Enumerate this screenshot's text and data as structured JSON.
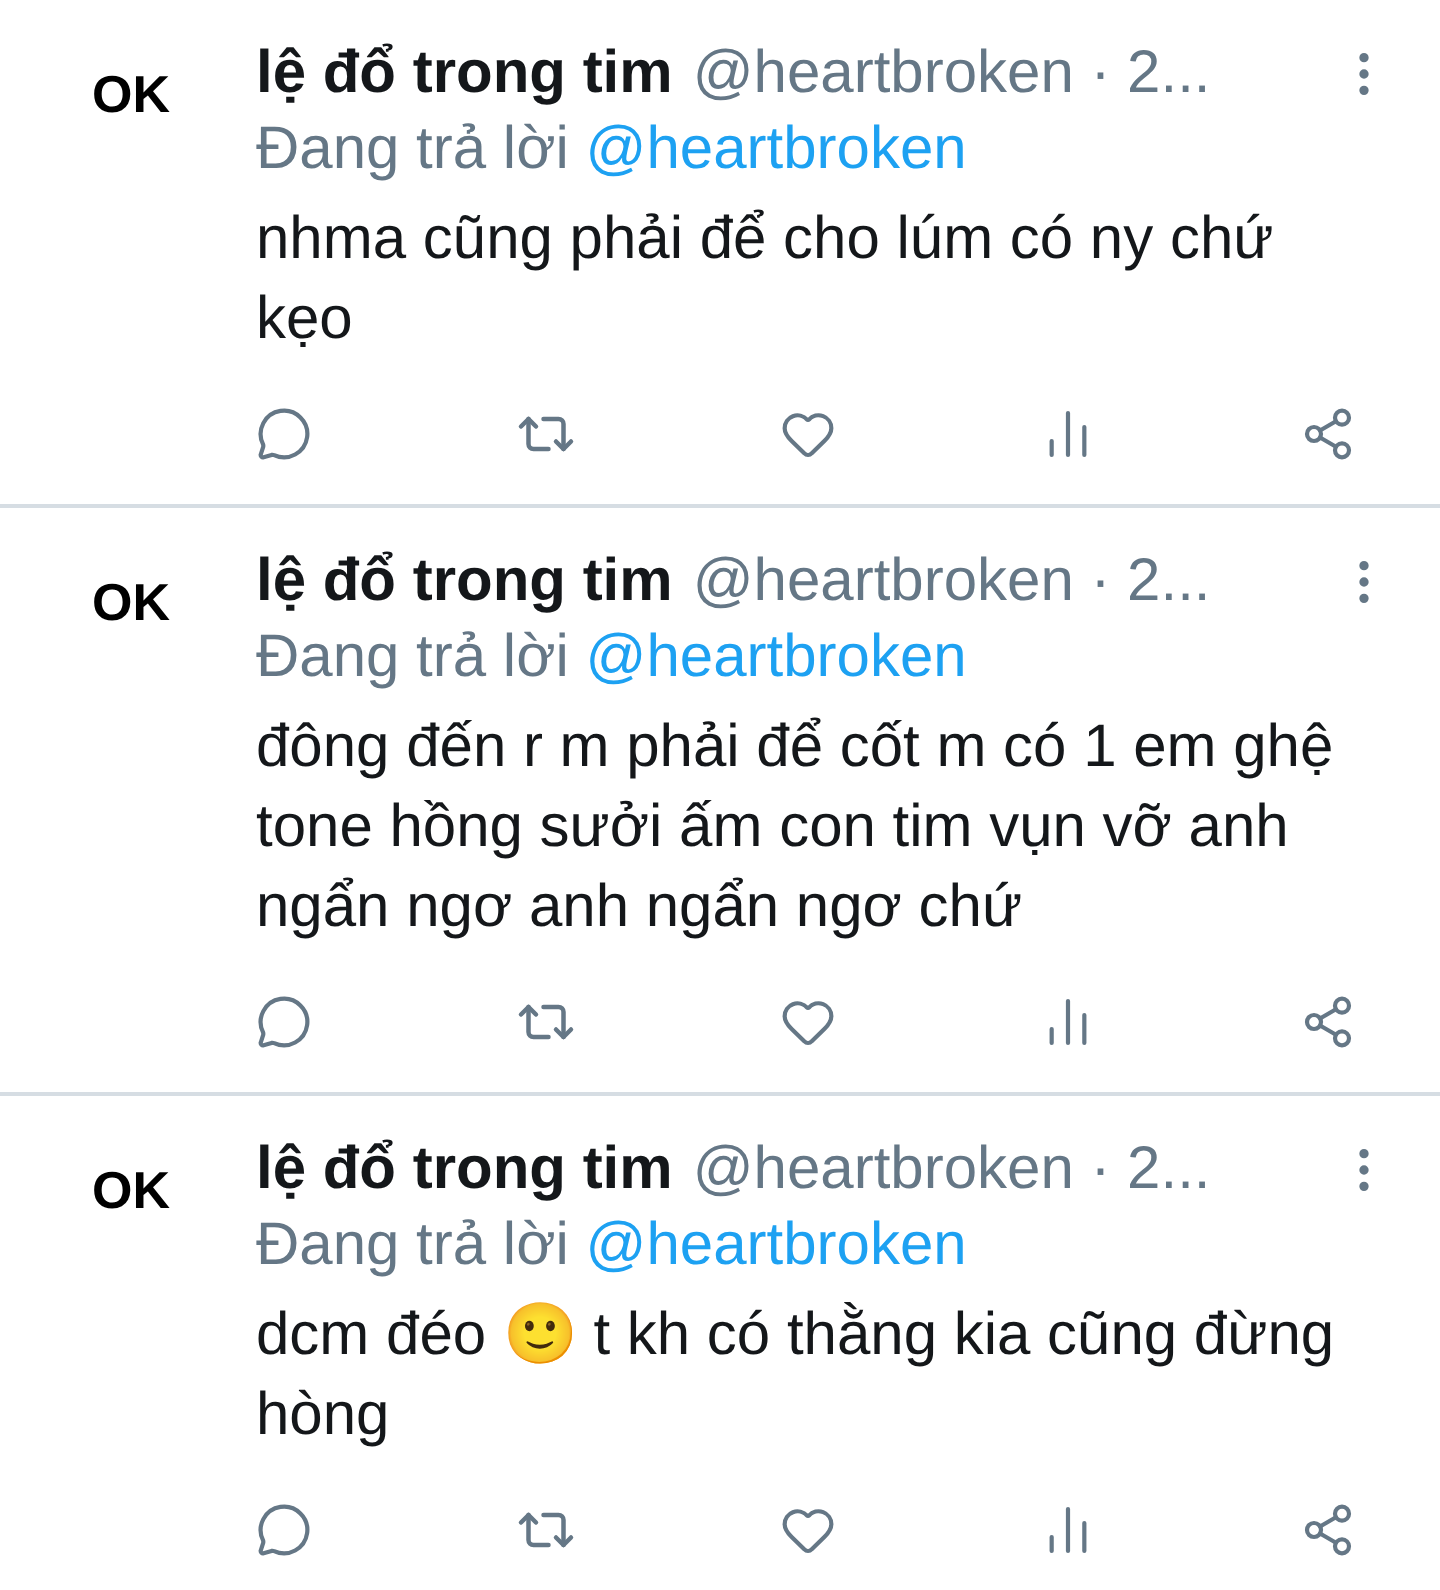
{
  "tweets": [
    {
      "avatar": {
        "label": "OK"
      },
      "name": "lệ đổ trong tim",
      "handle": "@heartbroken · 2...",
      "reply_prefix": "Đang trả lời",
      "reply_to": "@heartbroken",
      "text": "nhma cũng phải để cho lúm có ny chứ kẹo"
    },
    {
      "avatar": {
        "label": "OK"
      },
      "name": "lệ đổ trong tim",
      "handle": "@heartbroken · 2...",
      "reply_prefix": "Đang trả lời",
      "reply_to": "@heartbroken",
      "text": "đông đến r m phải để cốt m có 1 em ghệ tone hồng sưởi ấm con tim vụn vỡ anh ngẩn ngơ anh ngẩn ngơ chứ"
    },
    {
      "avatar": {
        "label": "OK"
      },
      "name": "lệ đổ trong tim",
      "handle": "@heartbroken · 2...",
      "reply_prefix": "Đang trả lời",
      "reply_to": "@heartbroken",
      "text": "dcm đéo 🙂 t kh có thằng kia cũng đừng hòng"
    }
  ]
}
